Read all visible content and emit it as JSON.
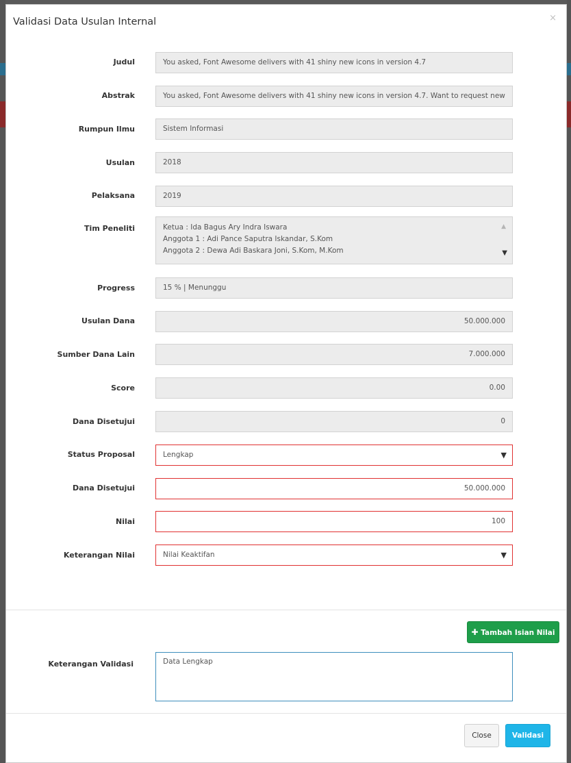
{
  "modal": {
    "title": "Validasi Data Usulan Internal",
    "close_symbol": "×"
  },
  "form": {
    "judul": {
      "label": "Judul",
      "value": "You asked, Font Awesome delivers with 41 shiny new icons in version 4.7"
    },
    "abstrak": {
      "label": "Abstrak",
      "value": "You asked, Font Awesome delivers with 41 shiny new icons in version 4.7. Want to request new"
    },
    "rumpun_ilmu": {
      "label": "Rumpun Ilmu",
      "value": "Sistem Informasi"
    },
    "usulan": {
      "label": "Usulan",
      "value": "2018"
    },
    "pelaksana": {
      "label": "Pelaksana",
      "value": "2019"
    },
    "tim_peneliti": {
      "label": "Tim Peneliti",
      "lines": [
        "Ketua : Ida Bagus Ary Indra Iswara",
        "Anggota 1 : Adi Pance Saputra Iskandar, S.Kom",
        "Anggota 2 : Dewa Adi Baskara Joni, S.Kom, M.Kom"
      ]
    },
    "progress": {
      "label": "Progress",
      "value": "15 %  |  Menunggu"
    },
    "usulan_dana": {
      "label": "Usulan Dana",
      "value": "50.000.000"
    },
    "sumber_dana_lain": {
      "label": "Sumber Dana Lain",
      "value": "7.000.000"
    },
    "score": {
      "label": "Score",
      "value": "0.00"
    },
    "dana_disetujui_ro": {
      "label": "Dana Disetujui",
      "value": "0"
    },
    "status_proposal": {
      "label": "Status Proposal",
      "value": "Lengkap"
    },
    "dana_disetujui": {
      "label": "Dana Disetujui",
      "value": "50.000.000"
    },
    "nilai": {
      "label": "Nilai",
      "value": "100"
    },
    "keterangan_nilai": {
      "label": "Keterangan Nilai",
      "value": "Nilai Keaktifan"
    },
    "keterangan_validasi": {
      "label": "Keterangan Validasi",
      "value": "Data Lengkap"
    }
  },
  "buttons": {
    "tambah_isian": "Tambah Isian Nilai",
    "close": "Close",
    "validasi": "Validasi"
  },
  "colors": {
    "error_border": "#e03030",
    "success": "#1e9e4a",
    "info": "#1fb5e8",
    "focus_border": "#3c8dbc"
  }
}
